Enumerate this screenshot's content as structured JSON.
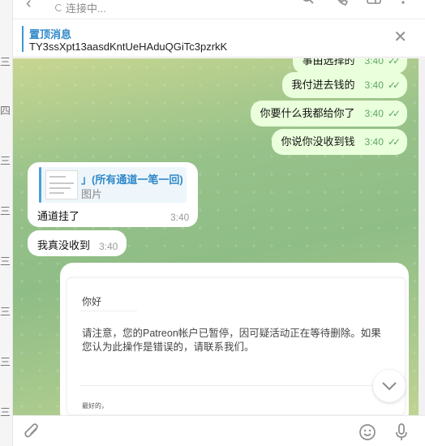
{
  "left_strip": {
    "chars": [
      "三",
      "四",
      "三",
      "三",
      "三",
      "三",
      "三",
      "三",
      "三"
    ]
  },
  "header": {
    "status": "连接中...",
    "back_icon": "arrow-left-icon",
    "icons": [
      "search-icon",
      "phone-icon",
      "sidebar-icon",
      "more-vertical-icon"
    ]
  },
  "pinned": {
    "title": "置顶消息",
    "text": "TY3ssXpt13aasdKntUeHAduQGiTc3pzrkK",
    "close_icon": "close-icon"
  },
  "messages_out": [
    {
      "text": "事由选择的",
      "time": "3:40"
    },
    {
      "text": "我付进去钱的",
      "time": "3:40"
    },
    {
      "text": "你要什么我都给你了",
      "time": "3:40"
    },
    {
      "text": "你说你没收到钱",
      "time": "3:40"
    }
  ],
  "message_in_reply": {
    "reply_title": "」(所有通道一笔一回)",
    "reply_sub": "图片",
    "text": "通道挂了",
    "time": "3:40"
  },
  "message_in_2": {
    "text": "我真没收到",
    "time": "3:40"
  },
  "image_message": {
    "greeting": "你好",
    "notice": "请注意，您的Patreon帐户已暂停，因可疑活动正在等待删除。如果您认为此操作是错误的，请联系我们。",
    "regards": "最好的，"
  },
  "colors": {
    "outgoing_bubble": "#eaffdc",
    "accent_blue": "#2f89c9",
    "check_green": "#5fa766"
  },
  "input_bar": {
    "icons": [
      "paperclip-icon",
      "emoji-icon",
      "microphone-icon"
    ]
  }
}
